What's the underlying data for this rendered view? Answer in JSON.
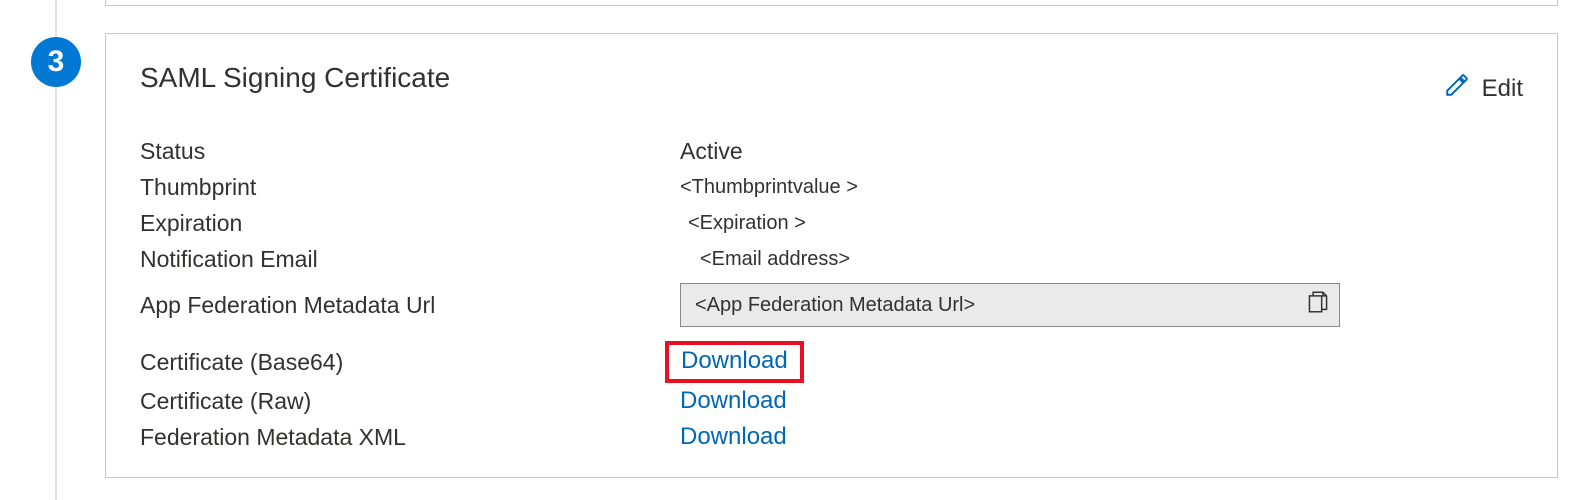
{
  "step": "3",
  "card": {
    "title": "SAML Signing Certificate",
    "editLabel": "Edit",
    "fields": {
      "statusLabel": "Status",
      "statusValue": "Active",
      "thumbprintLabel": "Thumbprint",
      "thumbprintValue": "<Thumbprintvalue >",
      "expirationLabel": "Expiration",
      "expirationValue": "<Expiration >",
      "notificationEmailLabel": "Notification Email",
      "notificationEmailValue": "<Email address>",
      "metadataUrlLabel": "App Federation Metadata Url",
      "metadataUrlValue": "<App Federation  Metadata Url>",
      "certBase64Label": "Certificate (Base64)",
      "certBase64Action": "Download",
      "certRawLabel": "Certificate (Raw)",
      "certRawAction": "Download",
      "fedXmlLabel": "Federation Metadata XML",
      "fedXmlAction": "Download"
    }
  },
  "colors": {
    "accent": "#0078d4",
    "link": "#0067b8",
    "highlight": "#e81123"
  }
}
